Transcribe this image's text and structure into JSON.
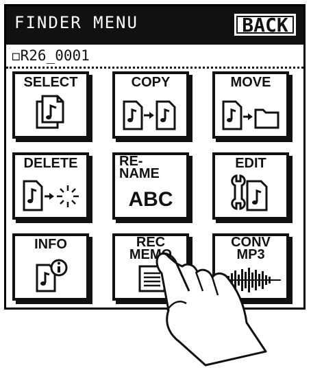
{
  "header": {
    "title": "FINDER MENU",
    "back_label": "BACK"
  },
  "file": {
    "name": "◻R26_0001"
  },
  "menu": {
    "select": "SELECT",
    "copy": "COPY",
    "move": "MOVE",
    "delete": "DELETE",
    "rename_line1": "RE-",
    "rename_line2": "NAME",
    "rename_sub": "ABC",
    "edit": "EDIT",
    "info": "INFO",
    "recmemo_line1": "REC",
    "recmemo_line2": "MEMO",
    "conv_line1": "CONV",
    "conv_line2": "MP3"
  }
}
